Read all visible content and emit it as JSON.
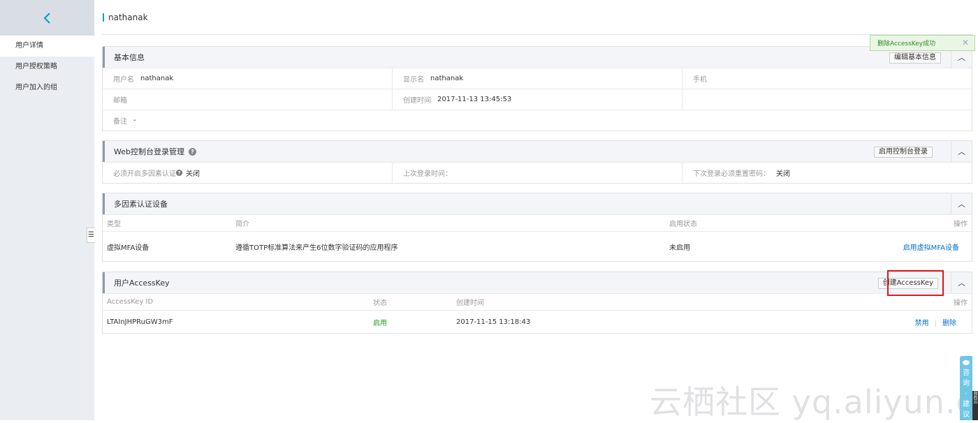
{
  "sidebar": {
    "items": [
      {
        "label": "用户详情"
      },
      {
        "label": "用户授权策略"
      },
      {
        "label": "用户加入的组"
      }
    ],
    "back_icon": "chevron-left-icon"
  },
  "header": {
    "title": "nathanak"
  },
  "toast": {
    "message": "删除AccessKey成功",
    "close": "✕"
  },
  "basic_info": {
    "title": "基本信息",
    "edit_button": "编辑基本信息",
    "username_label": "用户名",
    "username_value": "nathanak",
    "display_name_label": "显示名",
    "display_name_value": "nathanak",
    "phone_label": "手机",
    "email_label": "邮箱",
    "created_label": "创建时间",
    "created_value": "2017-11-13 13:45:53",
    "remark_label": "备注",
    "remark_value": "-"
  },
  "console_login": {
    "title": "Web控制台登录管理",
    "enable_button": "启用控制台登录",
    "mfa_required_label": "必须开启多因素认证",
    "mfa_required_value": "关闭",
    "last_login_label": "上次登录时间：",
    "reset_password_label": "下次登录必须重置密码：",
    "reset_password_value": "关闭"
  },
  "mfa": {
    "title": "多因素认证设备",
    "columns": {
      "type": "类型",
      "desc": "简介",
      "status": "启用状态",
      "action": "操作"
    },
    "row": {
      "type": "虚拟MFA设备",
      "desc": "遵循TOTP标准算法来产生6位数字验证码的应用程序",
      "status": "未启用",
      "action": "启用虚拟MFA设备"
    }
  },
  "accesskey": {
    "title": "用户AccessKey",
    "create_button": "创建AccessKey",
    "columns": {
      "id": "AccessKey ID",
      "status": "状态",
      "created": "创建时间",
      "action": "操作"
    },
    "row": {
      "id": "LTAInJHPRuGW3mF",
      "status": "启用",
      "created": "2017-11-15 13:18:43",
      "disable": "禁用",
      "delete": "删除"
    }
  },
  "watermark": "云栖社区 yq.aliyun.com",
  "feedback": {
    "chars": [
      "咨",
      "询",
      "·",
      "建",
      "议"
    ],
    "side_text": "我的云"
  },
  "colors": {
    "accent": "#00a2ca",
    "link": "#0070cc",
    "success": "#1e9c1e",
    "highlight": "#e0141e"
  }
}
